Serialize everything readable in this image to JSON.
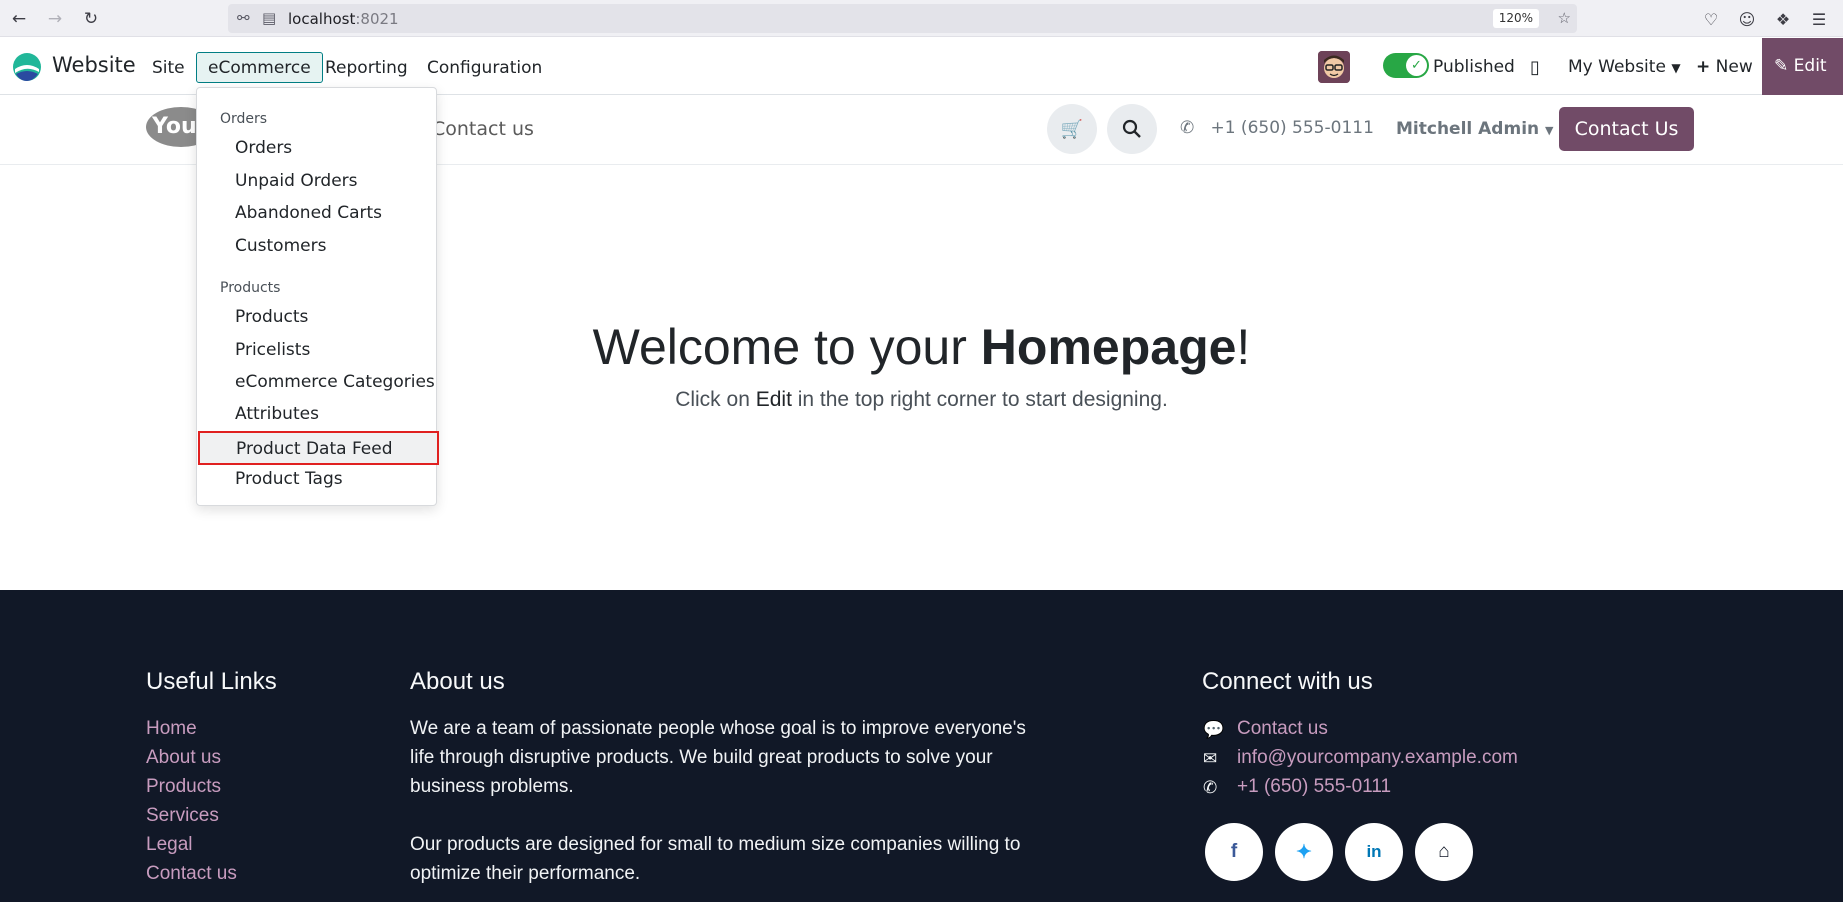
{
  "browser": {
    "url_host": "localhost",
    "url_port": ":8021",
    "zoom": "120%"
  },
  "navbar": {
    "app_name": "Website",
    "menu": [
      "Site",
      "eCommerce",
      "Reporting",
      "Configuration"
    ],
    "active_menu": "eCommerce",
    "published_label": "Published",
    "website_selector": "My Website",
    "new_label": "New",
    "edit_label": "Edit"
  },
  "site_header": {
    "logo_text": "Your",
    "nav_link": "Contact us",
    "phone": "+1 (650) 555-0111",
    "user": "Mitchell Admin",
    "cta": "Contact Us"
  },
  "dropdown": {
    "sections": [
      {
        "header": "Orders",
        "items": [
          "Orders",
          "Unpaid Orders",
          "Abandoned Carts",
          "Customers"
        ]
      },
      {
        "header": "Products",
        "items": [
          "Products",
          "Pricelists",
          "eCommerce Categories",
          "Attributes",
          "Product Data Feed",
          "Product Tags"
        ]
      }
    ],
    "highlighted": "Product Data Feed"
  },
  "hero": {
    "title_prefix": "Welcome to your ",
    "title_bold": "Homepage",
    "title_suffix": "!",
    "sub_prefix": "Click on ",
    "sub_edit": "Edit",
    "sub_suffix": " in the top right corner to start designing."
  },
  "footer": {
    "useful_links_title": "Useful Links",
    "useful_links": [
      "Home",
      "About us",
      "Products",
      "Services",
      "Legal",
      "Contact us"
    ],
    "about_title": "About us",
    "about_p1": "We are a team of passionate people whose goal is to improve everyone's life through disruptive products. We build great products to solve your business problems.",
    "about_p2": "Our products are designed for small to medium size companies willing to optimize their performance.",
    "connect_title": "Connect with us",
    "connect_items": [
      "Contact us",
      "info@yourcompany.example.com",
      "+1 (650) 555-0111"
    ],
    "social_icons": [
      "facebook-icon",
      "twitter-icon",
      "linkedin-icon",
      "home-icon"
    ]
  },
  "colors": {
    "brand": "#714b67",
    "active_menu_border": "#017e84",
    "published_toggle": "#28a745",
    "footer_bg": "#111827",
    "footer_link": "#c89cbf",
    "highlight_border": "#e02020"
  }
}
